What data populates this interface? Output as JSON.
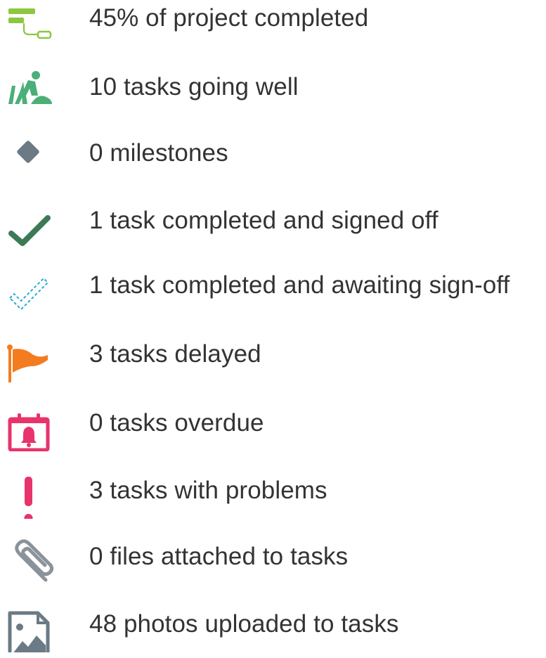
{
  "summary": {
    "items": [
      {
        "icon": "gantt-progress-icon",
        "label": "45% of project completed",
        "progress_percent": 45,
        "color": "#8dc63f"
      },
      {
        "icon": "worker-digging-icon",
        "label": "10 tasks going well",
        "color": "#4caf78"
      },
      {
        "icon": "milestone-diamond-icon",
        "label": "0 milestones",
        "color": "#6b7a84"
      },
      {
        "icon": "checkmark-icon",
        "label": "1 task completed and signed off",
        "color": "#3c7a56"
      },
      {
        "icon": "dashed-checkmark-icon",
        "label": "1 task completed and awaiting sign-off",
        "color": "#29a9d8"
      },
      {
        "icon": "delayed-flag-icon",
        "label": "3 tasks delayed",
        "color": "#f47c20"
      },
      {
        "icon": "calendar-alarm-icon",
        "label": "0 tasks overdue",
        "color": "#e8336b"
      },
      {
        "icon": "exclamation-icon",
        "label": "3 tasks with problems",
        "color": "#e8336b"
      },
      {
        "icon": "paperclip-icon",
        "label": "0 files attached to tasks",
        "color": "#8a9399"
      },
      {
        "icon": "photo-icon",
        "label": "48 photos uploaded to tasks",
        "color": "#6b7a84"
      }
    ]
  }
}
